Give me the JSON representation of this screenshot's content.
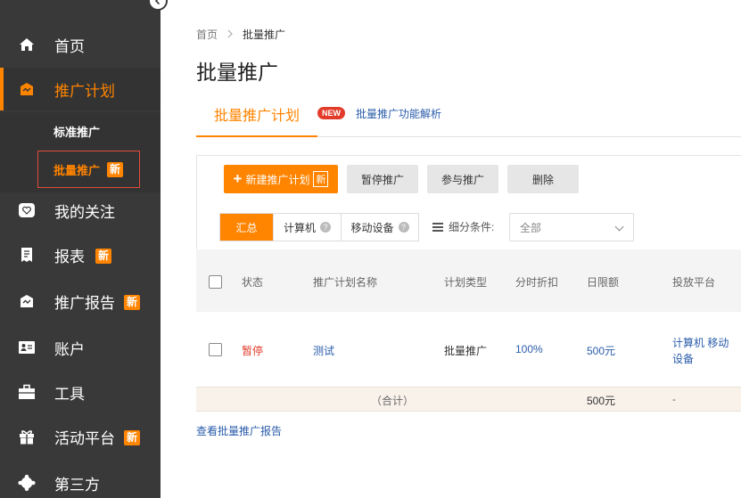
{
  "sidebar": {
    "items": [
      {
        "label": "首页",
        "icon": "home-icon"
      },
      {
        "label": "推广计划",
        "icon": "plan-icon"
      },
      {
        "label": "我的关注",
        "icon": "heart-icon"
      },
      {
        "label": "报表",
        "icon": "report-icon",
        "badge": "新"
      },
      {
        "label": "推广报告",
        "icon": "promo-report-icon",
        "badge": "新"
      },
      {
        "label": "账户",
        "icon": "account-icon"
      },
      {
        "label": "工具",
        "icon": "toolbox-icon"
      },
      {
        "label": "活动平台",
        "icon": "gift-icon",
        "badge": "新"
      },
      {
        "label": "第三方",
        "icon": "third-party-icon"
      }
    ],
    "sub_items": [
      {
        "label": "标准推广"
      },
      {
        "label": "批量推广",
        "badge": "新"
      }
    ]
  },
  "breadcrumb": {
    "home": "首页",
    "sep": ">",
    "current": "批量推广"
  },
  "page_title": "批量推广",
  "tabs": {
    "active": "批量推广计划",
    "new_pill": "NEW",
    "link": "批量推广功能解析"
  },
  "toolbar": {
    "new_plan": "新建推广计划",
    "new_badge": "新",
    "pause": "暂停推广",
    "join": "参与推广",
    "delete": "删除"
  },
  "filters": {
    "summary": "汇总",
    "computer": "计算机",
    "mobile": "移动设备",
    "condition_label": "细分条件:",
    "select_value": "全部"
  },
  "table": {
    "headers": [
      "状态",
      "推广计划名称",
      "计划类型",
      "分时折扣",
      "日限额",
      "投放平台"
    ],
    "rows": [
      {
        "status": "暂停",
        "name": "测试",
        "type": "批量推广",
        "discount": "100%",
        "limit": "500元",
        "platform": "计算机 移动设备"
      }
    ],
    "total": {
      "label": "（合计）",
      "limit": "500元",
      "platform": "-"
    }
  },
  "report_link": "查看批量推广报告",
  "colors": {
    "accent": "#ff8400",
    "sidebar_bg": "#393939",
    "link": "#2a5caa",
    "danger": "#e23b2a"
  }
}
